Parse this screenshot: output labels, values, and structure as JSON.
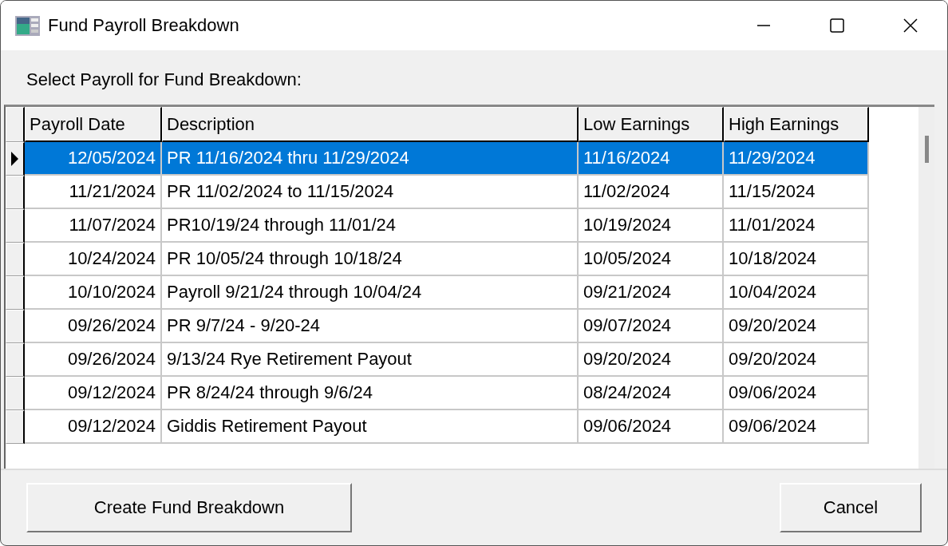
{
  "window": {
    "title": "Fund Payroll Breakdown"
  },
  "prompt": "Select Payroll for Fund Breakdown:",
  "table": {
    "columns": [
      "Payroll Date",
      "Description",
      "Low Earnings",
      "High Earnings"
    ],
    "rows": [
      {
        "cells": [
          "12/05/2024",
          "PR 11/16/2024 thru 11/29/2024",
          "11/16/2024",
          "11/29/2024"
        ],
        "selected": true
      },
      {
        "cells": [
          "11/21/2024",
          "PR 11/02/2024 to 11/15/2024",
          "11/02/2024",
          "11/15/2024"
        ],
        "selected": false
      },
      {
        "cells": [
          "11/07/2024",
          "PR10/19/24 through 11/01/24",
          "10/19/2024",
          "11/01/2024"
        ],
        "selected": false
      },
      {
        "cells": [
          "10/24/2024",
          "PR 10/05/24 through 10/18/24",
          "10/05/2024",
          "10/18/2024"
        ],
        "selected": false
      },
      {
        "cells": [
          "10/10/2024",
          "Payroll 9/21/24 through 10/04/24",
          "09/21/2024",
          "10/04/2024"
        ],
        "selected": false
      },
      {
        "cells": [
          "09/26/2024",
          "PR 9/7/24 - 9/20-24",
          "09/07/2024",
          "09/20/2024"
        ],
        "selected": false
      },
      {
        "cells": [
          "09/26/2024",
          "9/13/24 Rye Retirement Payout",
          "09/20/2024",
          "09/20/2024"
        ],
        "selected": false
      },
      {
        "cells": [
          "09/12/2024",
          "PR 8/24/24 through 9/6/24",
          "08/24/2024",
          "09/06/2024"
        ],
        "selected": false
      },
      {
        "cells": [
          "09/12/2024",
          "Giddis Retirement Payout",
          "09/06/2024",
          "09/06/2024"
        ],
        "selected": false
      }
    ]
  },
  "buttons": [
    "Create Fund Breakdown",
    "Cancel"
  ]
}
